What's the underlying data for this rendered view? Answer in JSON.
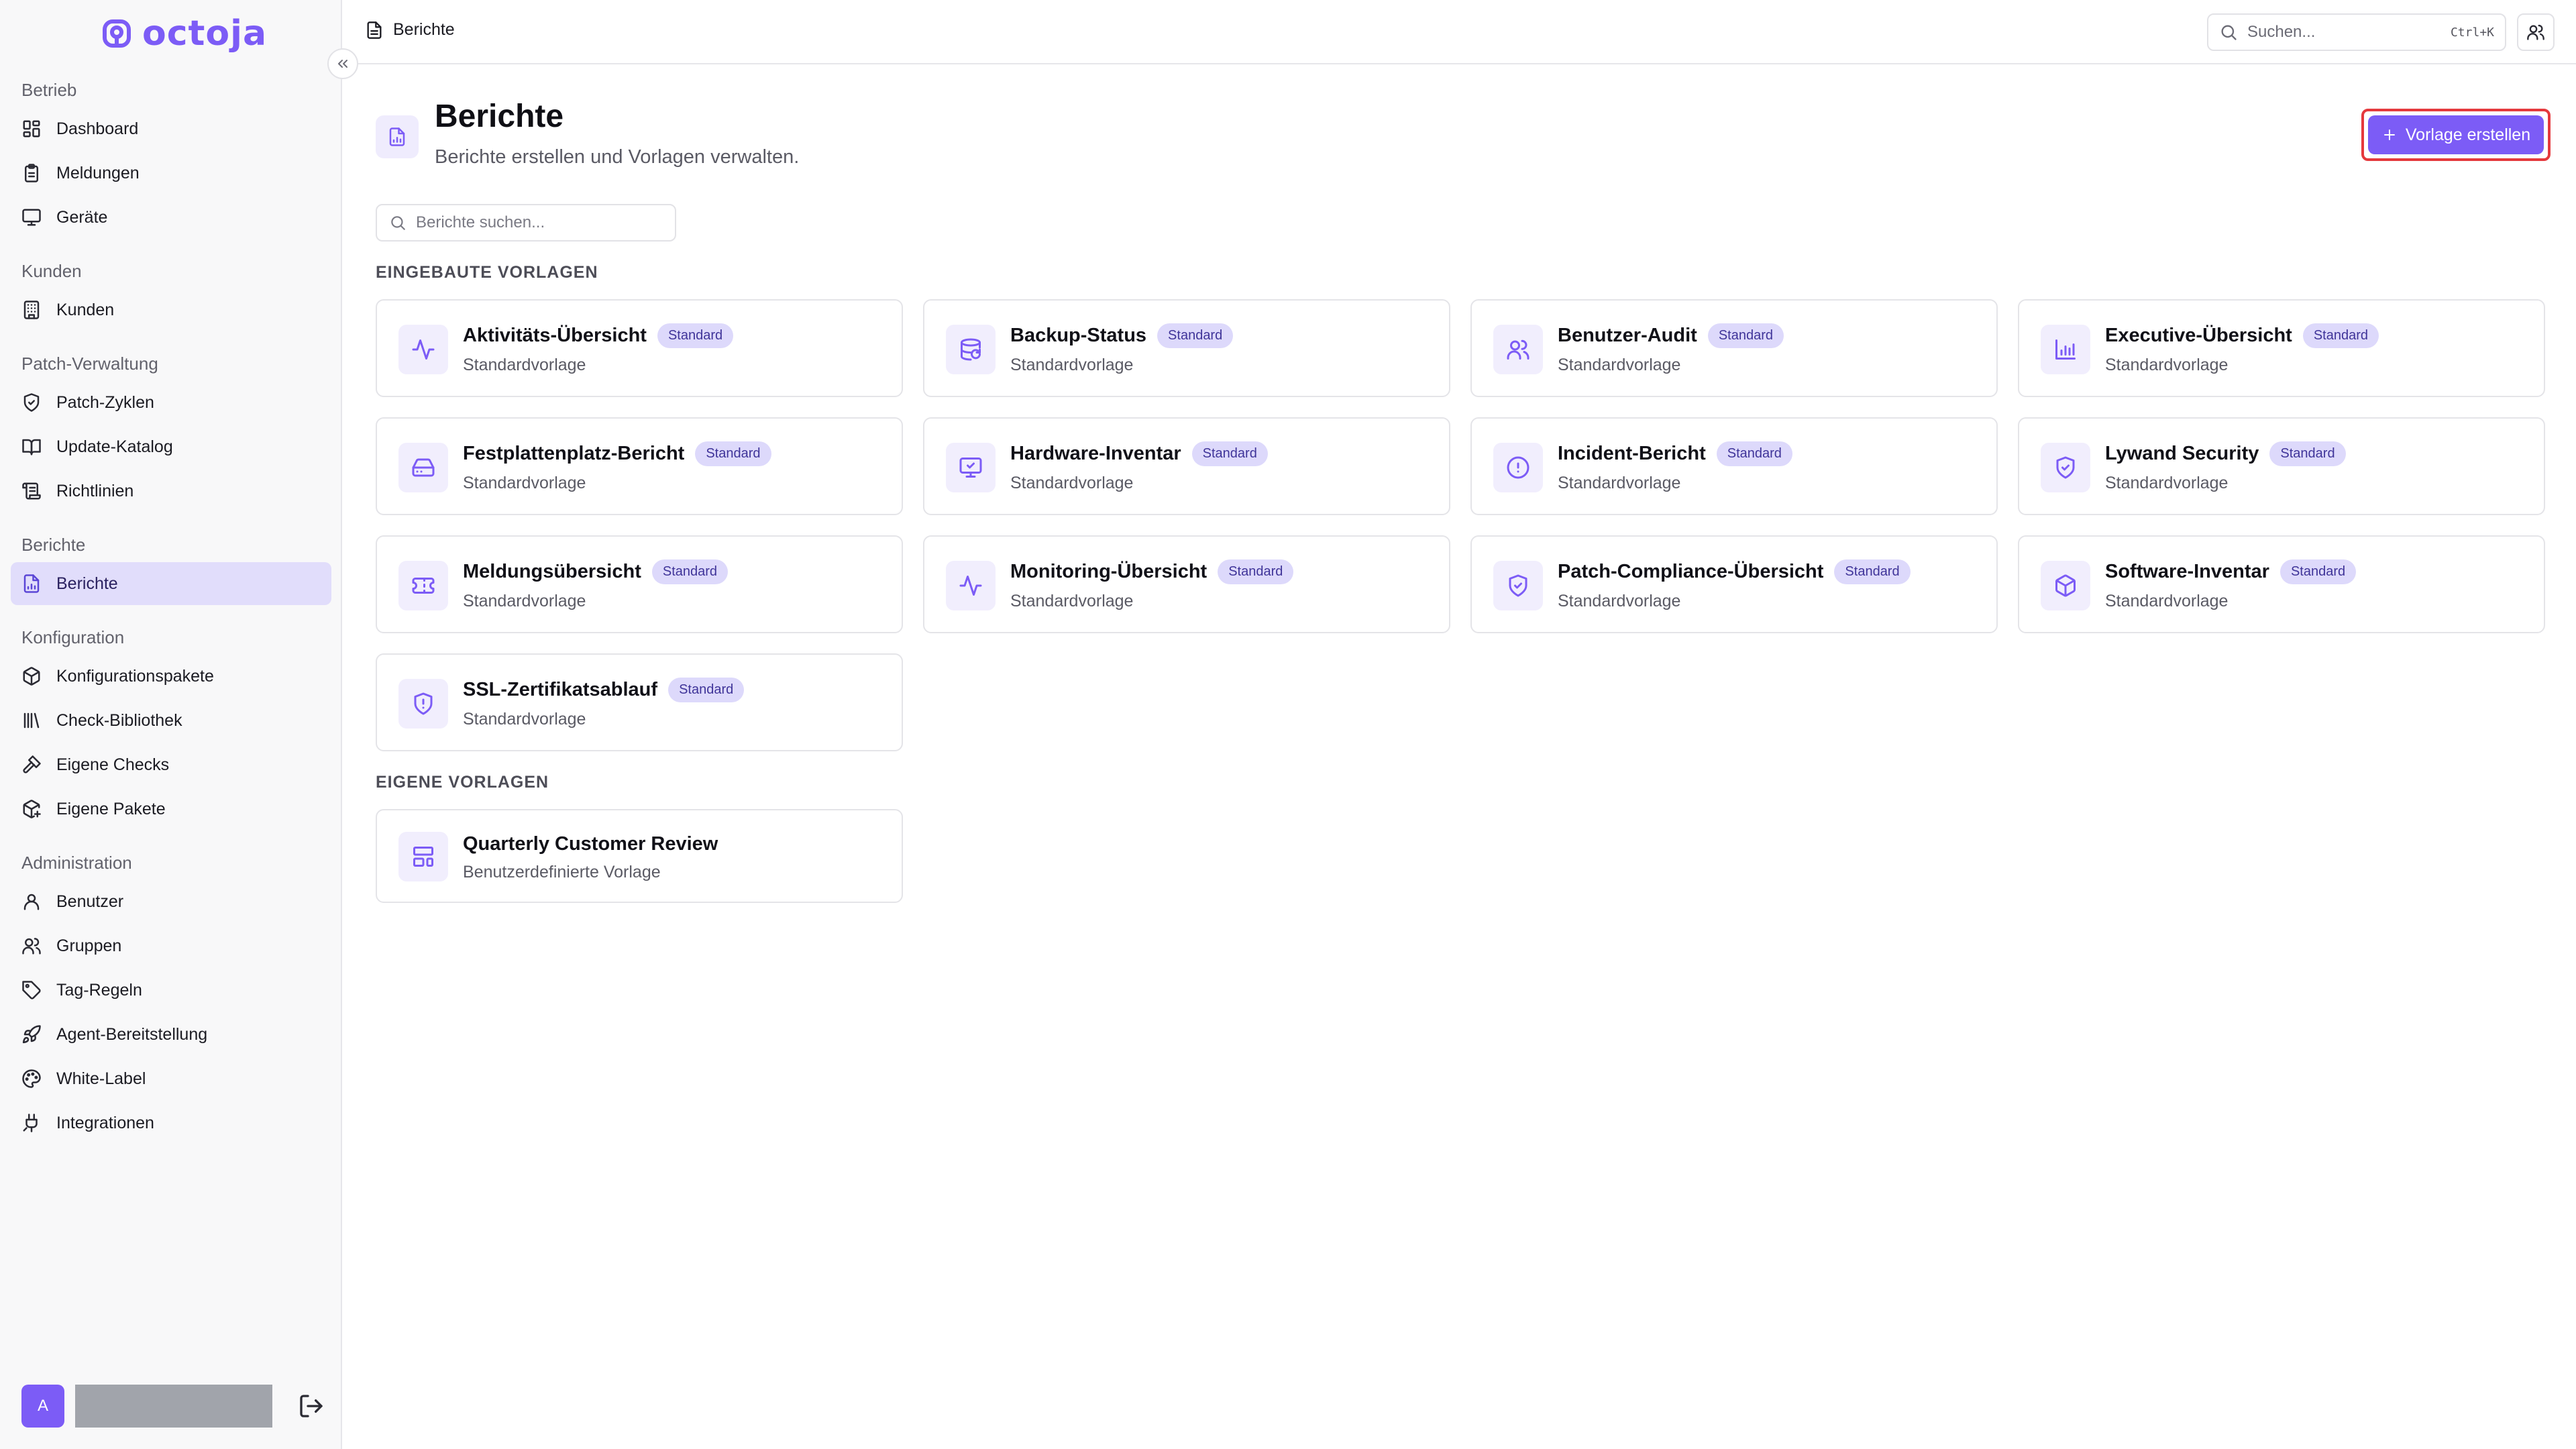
{
  "app": {
    "name": "octoja"
  },
  "sidebar": {
    "sections": [
      {
        "title": "Betrieb",
        "items": [
          {
            "label": "Dashboard",
            "icon": "dashboard-icon"
          },
          {
            "label": "Meldungen",
            "icon": "clipboard-icon"
          },
          {
            "label": "Geräte",
            "icon": "monitor-icon"
          }
        ]
      },
      {
        "title": "Kunden",
        "items": [
          {
            "label": "Kunden",
            "icon": "building-icon"
          }
        ]
      },
      {
        "title": "Patch-Verwaltung",
        "items": [
          {
            "label": "Patch-Zyklen",
            "icon": "shield-icon"
          },
          {
            "label": "Update-Katalog",
            "icon": "book-icon"
          },
          {
            "label": "Richtlinien",
            "icon": "scroll-icon"
          }
        ]
      },
      {
        "title": "Berichte",
        "items": [
          {
            "label": "Berichte",
            "icon": "file-chart-icon",
            "active": true
          }
        ]
      },
      {
        "title": "Konfiguration",
        "items": [
          {
            "label": "Konfigurationspakete",
            "icon": "package-icon"
          },
          {
            "label": "Check-Bibliothek",
            "icon": "library-icon"
          },
          {
            "label": "Eigene Checks",
            "icon": "hammer-icon"
          },
          {
            "label": "Eigene Pakete",
            "icon": "package-plus-icon"
          }
        ]
      },
      {
        "title": "Administration",
        "items": [
          {
            "label": "Benutzer",
            "icon": "user-icon"
          },
          {
            "label": "Gruppen",
            "icon": "users-icon"
          },
          {
            "label": "Tag-Regeln",
            "icon": "tag-icon"
          },
          {
            "label": "Agent-Bereitstellung",
            "icon": "rocket-icon"
          },
          {
            "label": "White-Label",
            "icon": "palette-icon"
          },
          {
            "label": "Integrationen",
            "icon": "plug-icon"
          }
        ]
      }
    ],
    "footer": {
      "avatar_initial": "A"
    }
  },
  "topbar": {
    "breadcrumb": "Berichte",
    "search_placeholder": "Suchen...",
    "search_shortcut": "Ctrl+K"
  },
  "page": {
    "title": "Berichte",
    "subtitle": "Berichte erstellen und Vorlagen verwalten.",
    "create_button": "Vorlage erstellen",
    "search_placeholder": "Berichte suchen...",
    "builtin_label": "EINGEBAUTE VORLAGEN",
    "custom_label": "EIGENE VORLAGEN"
  },
  "builtin_templates": [
    {
      "title": "Aktivitäts-Übersicht",
      "badge": "Standard",
      "subtitle": "Standardvorlage",
      "icon": "activity-icon"
    },
    {
      "title": "Backup-Status",
      "badge": "Standard",
      "subtitle": "Standardvorlage",
      "icon": "database-backup-icon"
    },
    {
      "title": "Benutzer-Audit",
      "badge": "Standard",
      "subtitle": "Standardvorlage",
      "icon": "users-icon"
    },
    {
      "title": "Executive-Übersicht",
      "badge": "Standard",
      "subtitle": "Standardvorlage",
      "icon": "bar-chart-icon"
    },
    {
      "title": "Festplattenplatz-Bericht",
      "badge": "Standard",
      "subtitle": "Standardvorlage",
      "icon": "hard-drive-icon"
    },
    {
      "title": "Hardware-Inventar",
      "badge": "Standard",
      "subtitle": "Standardvorlage",
      "icon": "monitor-check-icon"
    },
    {
      "title": "Incident-Bericht",
      "badge": "Standard",
      "subtitle": "Standardvorlage",
      "icon": "alert-circle-icon"
    },
    {
      "title": "Lywand Security",
      "badge": "Standard",
      "subtitle": "Standardvorlage",
      "icon": "shield-check-icon"
    },
    {
      "title": "Meldungsübersicht",
      "badge": "Standard",
      "subtitle": "Standardvorlage",
      "icon": "ticket-icon"
    },
    {
      "title": "Monitoring-Übersicht",
      "badge": "Standard",
      "subtitle": "Standardvorlage",
      "icon": "activity-icon"
    },
    {
      "title": "Patch-Compliance-Übersicht",
      "badge": "Standard",
      "subtitle": "Standardvorlage",
      "icon": "shield-check-icon"
    },
    {
      "title": "Software-Inventar",
      "badge": "Standard",
      "subtitle": "Standardvorlage",
      "icon": "package-icon"
    },
    {
      "title": "SSL-Zertifikatsablauf",
      "badge": "Standard",
      "subtitle": "Standardvorlage",
      "icon": "shield-alert-icon"
    }
  ],
  "custom_templates": [
    {
      "title": "Quarterly Customer Review",
      "subtitle": "Benutzerdefinierte Vorlage",
      "icon": "layout-icon"
    }
  ],
  "colors": {
    "accent": "#7c5cf6",
    "active_nav_bg": "#e1ddfb",
    "badge_bg": "#ddd9fb",
    "highlight_outline": "#e5393d"
  }
}
